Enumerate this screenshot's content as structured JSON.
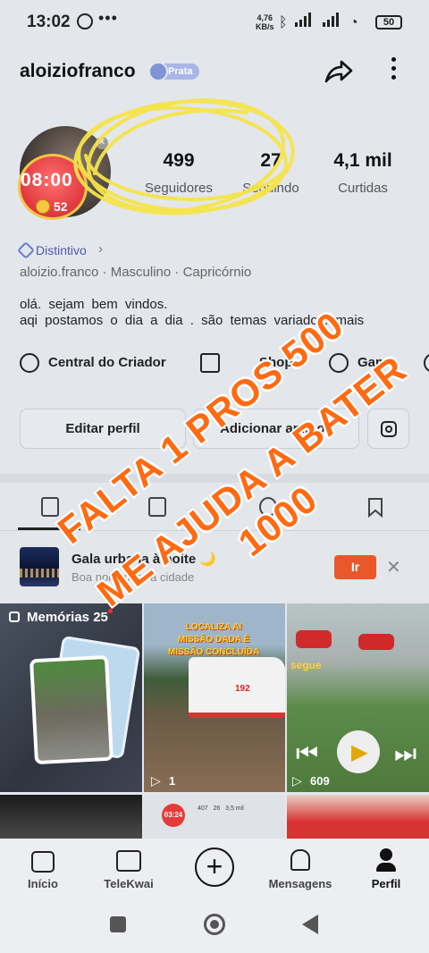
{
  "status_bar": {
    "time": "13:02",
    "dots": "•••",
    "net_speed_value": "4,76",
    "net_speed_unit": "KB/s",
    "battery": "50"
  },
  "header": {
    "username": "aloiziofranco",
    "badge": "Prata"
  },
  "avatar": {
    "live_time": "08:00",
    "coins": "52"
  },
  "stats": [
    {
      "value": "499",
      "label": "Seguidores"
    },
    {
      "value": "27",
      "label": "Seguindo"
    },
    {
      "value": "4,1 mil",
      "label": "Curtidas"
    }
  ],
  "profile": {
    "distintivo": "Distintivo",
    "meta": "aloizio.franco  ·  Masculino  ·  Capricórnio",
    "bio_line1": "olá.  sejam  bem  vindos.",
    "bio_line2": "aqi  postamos  o  dia  a  dia .  são  temas  variados.  mais"
  },
  "quick_links": [
    "Central do Criador",
    "Shop",
    "Game"
  ],
  "buttons": {
    "edit": "Editar perfil",
    "add": "Adicionar amigos"
  },
  "promo": {
    "title": "Gala urbana à noite",
    "emoji": "🌙",
    "subtitle": "Boa noite para a cidade",
    "cta": "Ir"
  },
  "grid": {
    "memorias": "Memórias 25",
    "tile2_caption_1": "LOCALIZA  AI",
    "tile2_caption_2": "MISSÃO DADA É",
    "tile2_caption_3": "MISSÃO CONCLUÍDA",
    "tile2_views": "1",
    "tile3_caption": "segue",
    "tile3_views": "609",
    "ambulance_number": "192",
    "mini_time": "03:24",
    "mini_stats": "407   26   3,5 mil"
  },
  "overlay": {
    "line1": "FALTA 1  PROS 500",
    "line2": "ME AJUDA A  BATER",
    "line3": "1000"
  },
  "nav": [
    {
      "label": "Início",
      "icon": "home-icon"
    },
    {
      "label": "TeleKwai",
      "icon": "film-icon"
    },
    {
      "label": "",
      "icon": "plus-icon"
    },
    {
      "label": "Mensagens",
      "icon": "bell-icon"
    },
    {
      "label": "Perfil",
      "icon": "person-icon"
    }
  ],
  "colors": {
    "accent": "#e8582a",
    "overlay_text": "#ff6a12",
    "scribble": "#f5e44a",
    "badge": "#a8b7e6"
  }
}
